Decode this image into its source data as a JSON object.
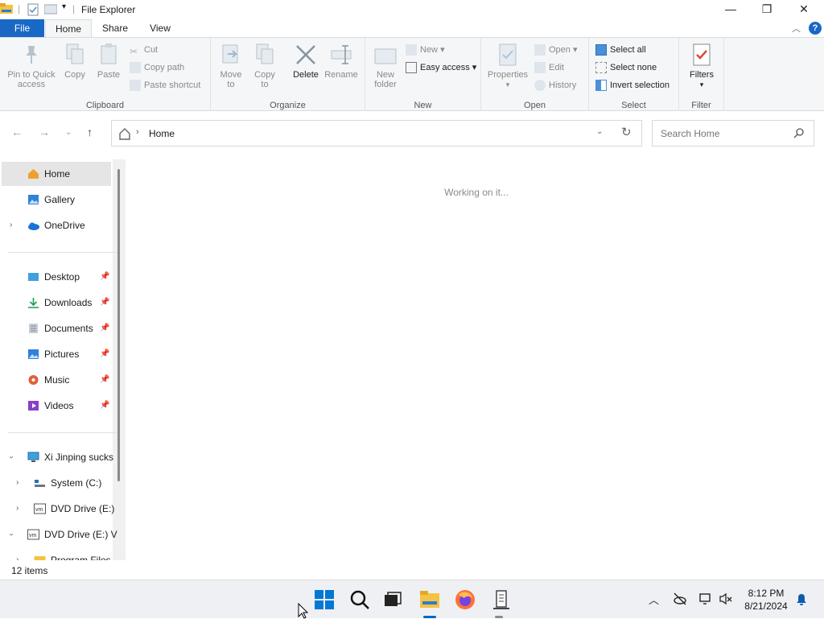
{
  "window": {
    "title": "File Explorer"
  },
  "tabs": {
    "file": "File",
    "home": "Home",
    "share": "Share",
    "view": "View",
    "help": "?"
  },
  "ribbon": {
    "clipboard": {
      "label": "Clipboard",
      "pin_line1": "Pin to Quick",
      "pin_line2": "access",
      "copy": "Copy",
      "paste": "Paste",
      "cut": "Cut",
      "copy_path": "Copy path",
      "paste_shortcut": "Paste shortcut"
    },
    "organize": {
      "label": "Organize",
      "move_line1": "Move",
      "move_line2": "to",
      "copy_line1": "Copy",
      "copy_line2": "to",
      "delete": "Delete",
      "rename": "Rename"
    },
    "new": {
      "label": "New",
      "folder_line1": "New",
      "folder_line2": "folder",
      "new_item": "New",
      "easy_access": "Easy access"
    },
    "open": {
      "label": "Open",
      "properties": "Properties",
      "open": "Open",
      "edit": "Edit",
      "history": "History"
    },
    "select": {
      "label": "Select",
      "select_all": "Select all",
      "select_none": "Select none",
      "invert": "Invert selection"
    },
    "filter": {
      "label": "Filter",
      "filters": "Filters"
    }
  },
  "address": {
    "crumb": "Home"
  },
  "search": {
    "placeholder": "Search Home"
  },
  "sidebar": {
    "items": [
      {
        "label": "Home"
      },
      {
        "label": "Gallery"
      },
      {
        "label": "OneDrive"
      },
      {
        "label": "Desktop"
      },
      {
        "label": "Downloads"
      },
      {
        "label": "Documents"
      },
      {
        "label": "Pictures"
      },
      {
        "label": "Music"
      },
      {
        "label": "Videos"
      },
      {
        "label": "Xi Jinping sucks"
      },
      {
        "label": "System (C:)"
      },
      {
        "label": "DVD Drive (E:)"
      },
      {
        "label": "DVD Drive (E:) V"
      },
      {
        "label": "Program Files"
      }
    ]
  },
  "content": {
    "status_message": "Working on it..."
  },
  "statusbar": {
    "item_count": "12 items"
  },
  "taskbar": {
    "time": "8:12 PM",
    "date": "8/21/2024"
  },
  "colors": {
    "accent": "#1968c6",
    "selected": "#e5e5e5"
  }
}
